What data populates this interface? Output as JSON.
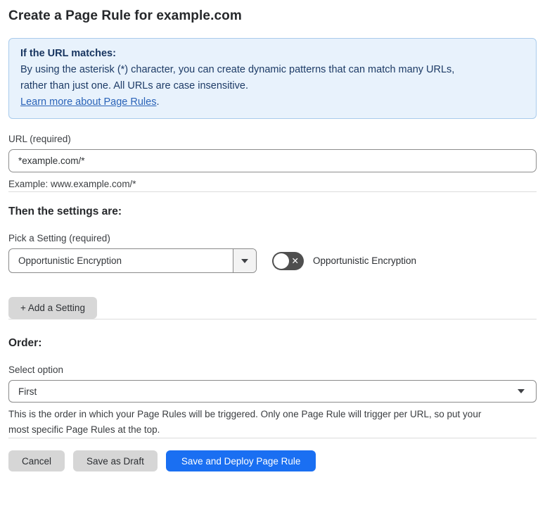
{
  "page": {
    "title": "Create a Page Rule for example.com"
  },
  "info_box": {
    "heading": "If the URL matches:",
    "body_lines": [
      "By using the asterisk (*) character, you can create dynamic patterns that can match many URLs,",
      "rather than just one. All URLs are case insensitive."
    ],
    "link_label": "Learn more about Page Rules",
    "link_suffix": "."
  },
  "url_field": {
    "label": "URL (required)",
    "value": "*example.com/*",
    "helper": "Example: www.example.com/*"
  },
  "settings_section": {
    "heading": "Then the settings are:",
    "picker_label": "Pick a Setting (required)",
    "selected_setting": "Opportunistic Encryption",
    "toggle": {
      "state": "off",
      "off_glyph": "✕",
      "label": "Opportunistic Encryption"
    },
    "add_setting_button": "+ Add a Setting"
  },
  "order_section": {
    "heading": "Order:",
    "select_label": "Select option",
    "selected_option": "First",
    "helper_lines": [
      "This is the order in which your Page Rules will be triggered. Only one Page Rule will trigger per URL, so put your",
      "most specific Page Rules at the top."
    ]
  },
  "footer": {
    "cancel_label": "Cancel",
    "save_draft_label": "Save as Draft",
    "save_deploy_label": "Save and Deploy Page Rule"
  },
  "colors": {
    "info_background": "#e8f2fc",
    "info_border": "#a9cbec",
    "info_text": "#1d3b66",
    "link": "#2a63b8",
    "primary_button": "#1a6ff2",
    "gray_button": "#d6d6d6",
    "toggle_off": "#4f4f4f"
  }
}
